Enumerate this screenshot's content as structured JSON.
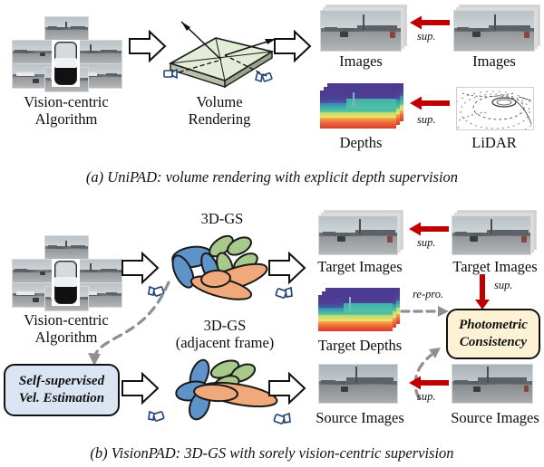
{
  "figure": {
    "panels": [
      {
        "id": "a",
        "caption": "(a) UniPAD: volume rendering with explicit depth supervision",
        "nodes": {
          "input_label_line1": "Vision-centric",
          "input_label_line2": "Algorithm",
          "stage_label_line1": "Volume",
          "stage_label_line2": "Rendering",
          "output_images_label": "Images",
          "output_depths_label": "Depths",
          "gt_images_label": "Images",
          "gt_lidar_label": "LiDAR"
        },
        "edges": [
          {
            "id": "sup-images",
            "label": "sup.",
            "kind": "red-arrow-left"
          },
          {
            "id": "sup-depths",
            "label": "sup.",
            "kind": "red-arrow-left"
          }
        ]
      },
      {
        "id": "b",
        "caption": "(b) VisionPAD: 3D-GS with sorely vision-centric supervision",
        "nodes": {
          "input_label_line1": "Vision-centric",
          "input_label_line2": "Algorithm",
          "gs_label": "3D-GS",
          "gs_adjacent_line1": "3D-GS",
          "gs_adjacent_line2": "(adjacent frame)",
          "vel_box_line1": "Self-supervised",
          "vel_box_line2": "Vel. Estimation",
          "photometric_box_line1": "Photometric",
          "photometric_box_line2": "Consistency",
          "target_images_label": "Target Images",
          "target_depths_label": "Target Depths",
          "source_images_label": "Source Images",
          "gt_target_images_label": "Target Images",
          "gt_source_images_label": "Source Images"
        },
        "edges": [
          {
            "id": "sup-target",
            "label": "sup.",
            "kind": "red-arrow-left"
          },
          {
            "id": "sup-photometric",
            "label": "sup.",
            "kind": "red-arrow-down"
          },
          {
            "id": "sup-source",
            "label": "sup.",
            "kind": "red-arrow-left"
          },
          {
            "id": "reproject",
            "label": "re-pro.",
            "kind": "gray-dashed-arrow"
          }
        ]
      }
    ],
    "colors": {
      "red_arrow": "#c00000",
      "gaussian_blue": "#5e93c9",
      "gaussian_green": "#a7c98a",
      "gaussian_orange": "#efa97a",
      "vel_box_fill": "#dbe4f3",
      "photometric_box_fill": "#fdf2d4",
      "volume_slab_fill": "#e3ecd6",
      "dashed_gray": "#8f8f8f",
      "camera_icon": "#23477a"
    }
  }
}
